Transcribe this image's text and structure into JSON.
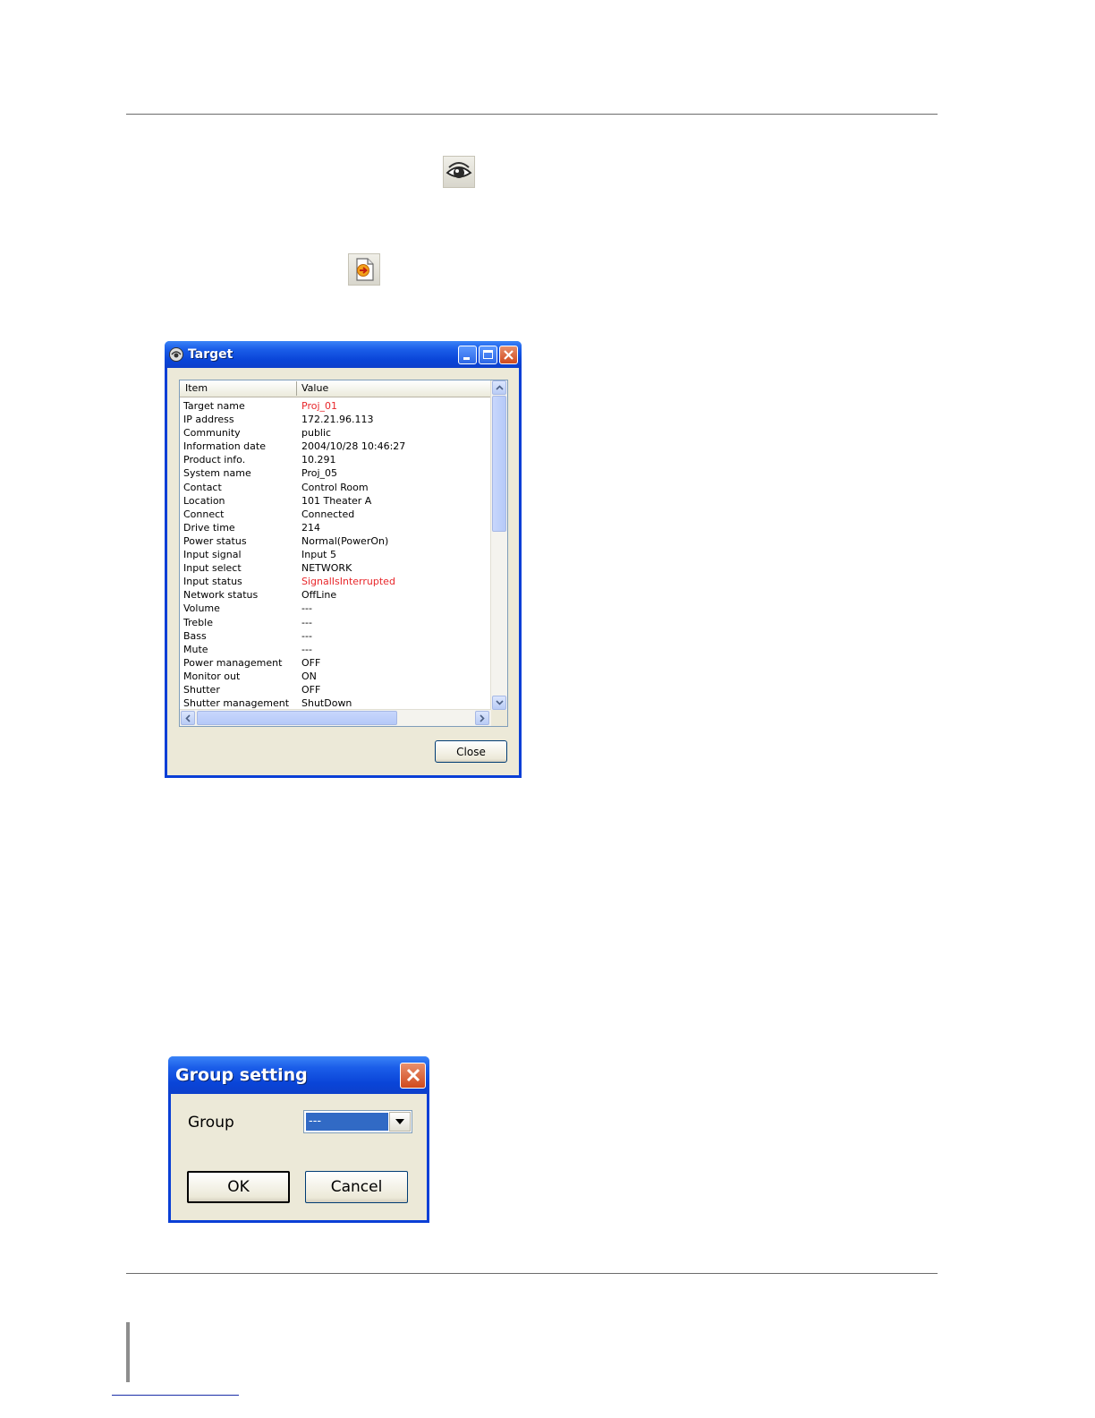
{
  "target_window": {
    "title": "Target",
    "columns": {
      "item": "Item",
      "value": "Value"
    },
    "rows": [
      {
        "item": "Target name",
        "value": "Proj_01",
        "alert": true
      },
      {
        "item": "IP address",
        "value": "172.21.96.113",
        "alert": false
      },
      {
        "item": "Community",
        "value": "public",
        "alert": false
      },
      {
        "item": "Information date",
        "value": "2004/10/28 10:46:27",
        "alert": false
      },
      {
        "item": "Product info.",
        "value": "10.291",
        "alert": false
      },
      {
        "item": "System name",
        "value": "Proj_05",
        "alert": false
      },
      {
        "item": "Contact",
        "value": "Control Room",
        "alert": false
      },
      {
        "item": "Location",
        "value": "101 Theater A",
        "alert": false
      },
      {
        "item": "Connect",
        "value": "Connected",
        "alert": false
      },
      {
        "item": "Drive time",
        "value": "214",
        "alert": false
      },
      {
        "item": "Power status",
        "value": "Normal(PowerOn)",
        "alert": false
      },
      {
        "item": "Input signal",
        "value": "Input 5",
        "alert": false
      },
      {
        "item": "Input select",
        "value": "NETWORK",
        "alert": false
      },
      {
        "item": "Input status",
        "value": "SignalIsInterrupted",
        "alert": true
      },
      {
        "item": "Network status",
        "value": "OffLine",
        "alert": false
      },
      {
        "item": "Volume",
        "value": "---",
        "alert": false
      },
      {
        "item": "Treble",
        "value": "---",
        "alert": false
      },
      {
        "item": "Bass",
        "value": "---",
        "alert": false
      },
      {
        "item": "Mute",
        "value": "---",
        "alert": false
      },
      {
        "item": "Power management",
        "value": "OFF",
        "alert": false
      },
      {
        "item": "Monitor out",
        "value": "ON",
        "alert": false
      },
      {
        "item": "Shutter",
        "value": "OFF",
        "alert": false
      },
      {
        "item": "Shutter management",
        "value": "ShutDown",
        "alert": false
      }
    ],
    "close_label": "Close"
  },
  "group_dialog": {
    "title": "Group setting",
    "group_label": "Group",
    "group_value": "---",
    "ok_label": "OK",
    "cancel_label": "Cancel"
  },
  "colors": {
    "alert_text": "#e8272b",
    "title_bar": "#0a45d8",
    "selection": "#316ac5"
  },
  "icons": [
    "eye-icon",
    "document-arrow-icon"
  ]
}
